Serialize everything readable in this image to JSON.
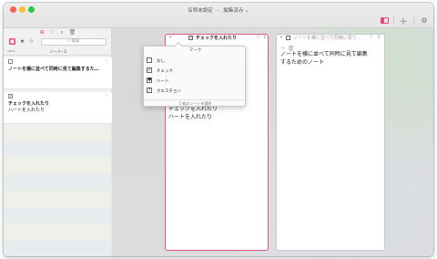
{
  "window": {
    "title": "名称未設定",
    "status": "編集済み",
    "separator": "—",
    "chevron": "⌄"
  },
  "toolbar": {
    "sidebar_icon": "sidebar-icon",
    "plus_label": "＋",
    "gear_label": "⚙"
  },
  "sidebar": {
    "top_icons": [
      "⊞",
      "♡",
      "⌕",
      "🗑"
    ],
    "filters": [
      "▣",
      "★",
      "☆"
    ],
    "search_placeholder": "⌕ 検索",
    "count_label": "ノート: 2",
    "count_icon": "▭▭",
    "notes": [
      {
        "mark": "",
        "star": "☆",
        "title": "ノートを横に並べて同時に見て編集するた…",
        "subtitle": ""
      },
      {
        "mark": "?",
        "star": "☆",
        "title": "チェックを入れたり",
        "subtitle": "ハートを入れたり"
      }
    ]
  },
  "panels": [
    {
      "close": "×",
      "mark": "?",
      "title": "チェックを入れたり",
      "star": "☆",
      "info": "ℹ",
      "body": [
        "チェックを入れたり",
        "ハートを入れたり"
      ]
    },
    {
      "close": "×",
      "mark": "",
      "title": "ノートを横に並べて同時に見て…",
      "star": "☆",
      "info": "ℹ",
      "tools": "＋ 🗑",
      "body": [
        "ノートを横に並べて同時に見て編集",
        "するためのノート"
      ]
    }
  ],
  "popover": {
    "title": "マーク",
    "items": [
      {
        "icon": "",
        "label": "なし"
      },
      {
        "icon": "✓",
        "label": "チェック"
      },
      {
        "icon": "♥",
        "label": "ハート"
      },
      {
        "icon": "?",
        "label": "クエスチョン"
      }
    ],
    "footer": "1 個のノートを選択"
  }
}
